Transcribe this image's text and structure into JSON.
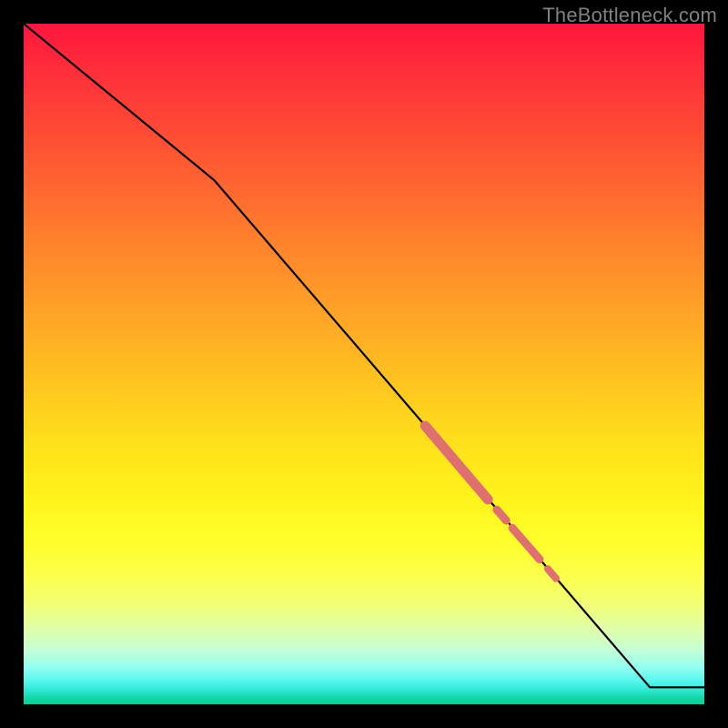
{
  "watermark": "TheBottleneck.com",
  "colors": {
    "line": "#000000",
    "highlight": "#e06f6f",
    "background_frame": "#000000"
  },
  "chart_data": {
    "type": "line",
    "title": "",
    "xlabel": "",
    "ylabel": "",
    "xlim": [
      0,
      100
    ],
    "ylim": [
      0,
      100
    ],
    "grid": false,
    "series": [
      {
        "name": "curve",
        "x": [
          0,
          28,
          92,
          100
        ],
        "y": [
          100,
          77,
          2.5,
          2.5
        ]
      }
    ],
    "highlight_segments": [
      {
        "x0": 59.0,
        "y0": 40.9,
        "x1": 68.2,
        "y1": 30.1,
        "width": 11
      },
      {
        "x0": 69.5,
        "y0": 28.6,
        "x1": 70.9,
        "y1": 27.0,
        "width": 9
      },
      {
        "x0": 71.8,
        "y0": 25.9,
        "x1": 75.8,
        "y1": 21.3,
        "width": 9
      },
      {
        "x0": 77.0,
        "y0": 19.9,
        "x1": 78.2,
        "y1": 18.5,
        "width": 8
      }
    ]
  }
}
